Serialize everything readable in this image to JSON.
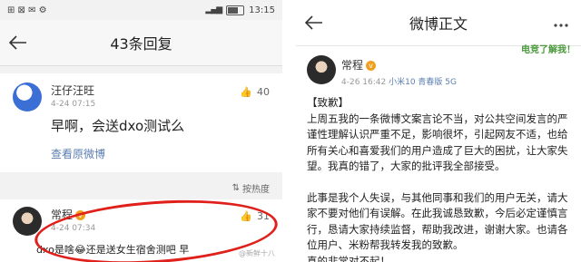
{
  "left": {
    "status": {
      "left_icons": "⊞ ⊠ ✉ ⚙",
      "signal": "▂▄▆",
      "time": "13:15"
    },
    "header": {
      "title": "43条回复"
    },
    "comment": {
      "user": "汪仔汪旺",
      "time": "4-24 07:15",
      "text": "早啊，会送dxo测试么",
      "likes": "40",
      "link": "查看原微博"
    },
    "sort_label": "按热度",
    "reply": {
      "user": "常程",
      "time": "4-24 07:34",
      "likes": "31",
      "text": "dxo是啥😂还是送女生宿舍测吧 早"
    },
    "watermark": "@新鲜十八"
  },
  "right": {
    "header": {
      "title": "微博正文"
    },
    "sticker": "电竞了解我！",
    "post": {
      "user": "常程",
      "time": "4-26 16:42",
      "device": "小米10 青春版 5G",
      "body": [
        "【致歉】",
        "上周五我的一条微博文案言论不当，对公共空间发言的严谨性理解认识严重不足，影响很坏，引起网友不适，也给所有关心和喜爱我们的用户造成了巨大的困扰，让大家失望。我真的错了，大家的批评我全部接受。",
        "",
        "此事是我个人失误，与其他同事和我们的用户无关，请大家不要对他们有误解。在此我诚恳致歉，今后必定谨慎言行，恳请大家持续监督，帮助我改进，谢谢大家。也请各位用户、米粉帮我转发我的致歉。",
        "真的非常对不起！"
      ]
    }
  }
}
